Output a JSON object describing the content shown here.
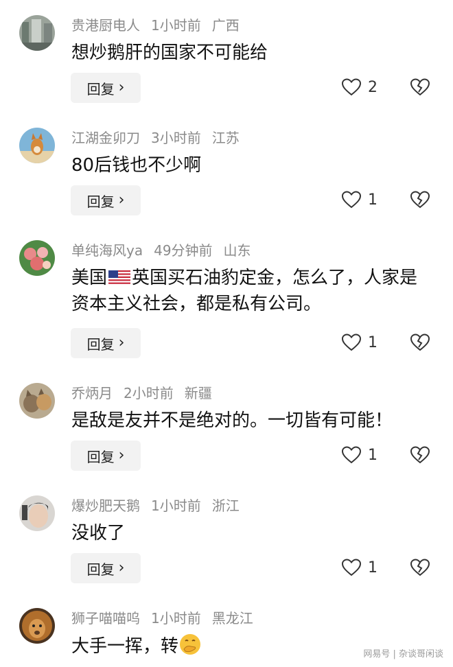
{
  "comments": [
    {
      "user": "贵港厨电人",
      "time": "1小时前",
      "location": "广西",
      "text": "想炒鹅肝的国家不可能给",
      "likes": "2"
    },
    {
      "user": "江湖金卯刀",
      "time": "3小时前",
      "location": "江苏",
      "text": "80后钱也不少啊",
      "likes": "1"
    },
    {
      "user": "单纯海风ya",
      "time": "49分钟前",
      "location": "山东",
      "text_before_flag": "美国",
      "text_after_flag": "英国买石油豹定金，怎么了，人家是资本主义社会，都是私有公司。",
      "likes": "1"
    },
    {
      "user": "乔炳月",
      "time": "2小时前",
      "location": "新疆",
      "text": "是敌是友并不是绝对的。一切皆有可能！",
      "likes": "1"
    },
    {
      "user": "爆炒肥天鹅",
      "time": "1小时前",
      "location": "浙江",
      "text": "没收了",
      "likes": "1"
    },
    {
      "user": "狮子喵喵呜",
      "time": "1小时前",
      "location": "黑龙江",
      "text": "大手一挥，转"
    }
  ],
  "reply_label": "回复",
  "icons": {
    "like": "heart-outline-icon",
    "dislike": "broken-heart-icon",
    "reply_chevron": "chevron-right-icon"
  },
  "watermark": "网易号 | 杂谈哥闲谈"
}
